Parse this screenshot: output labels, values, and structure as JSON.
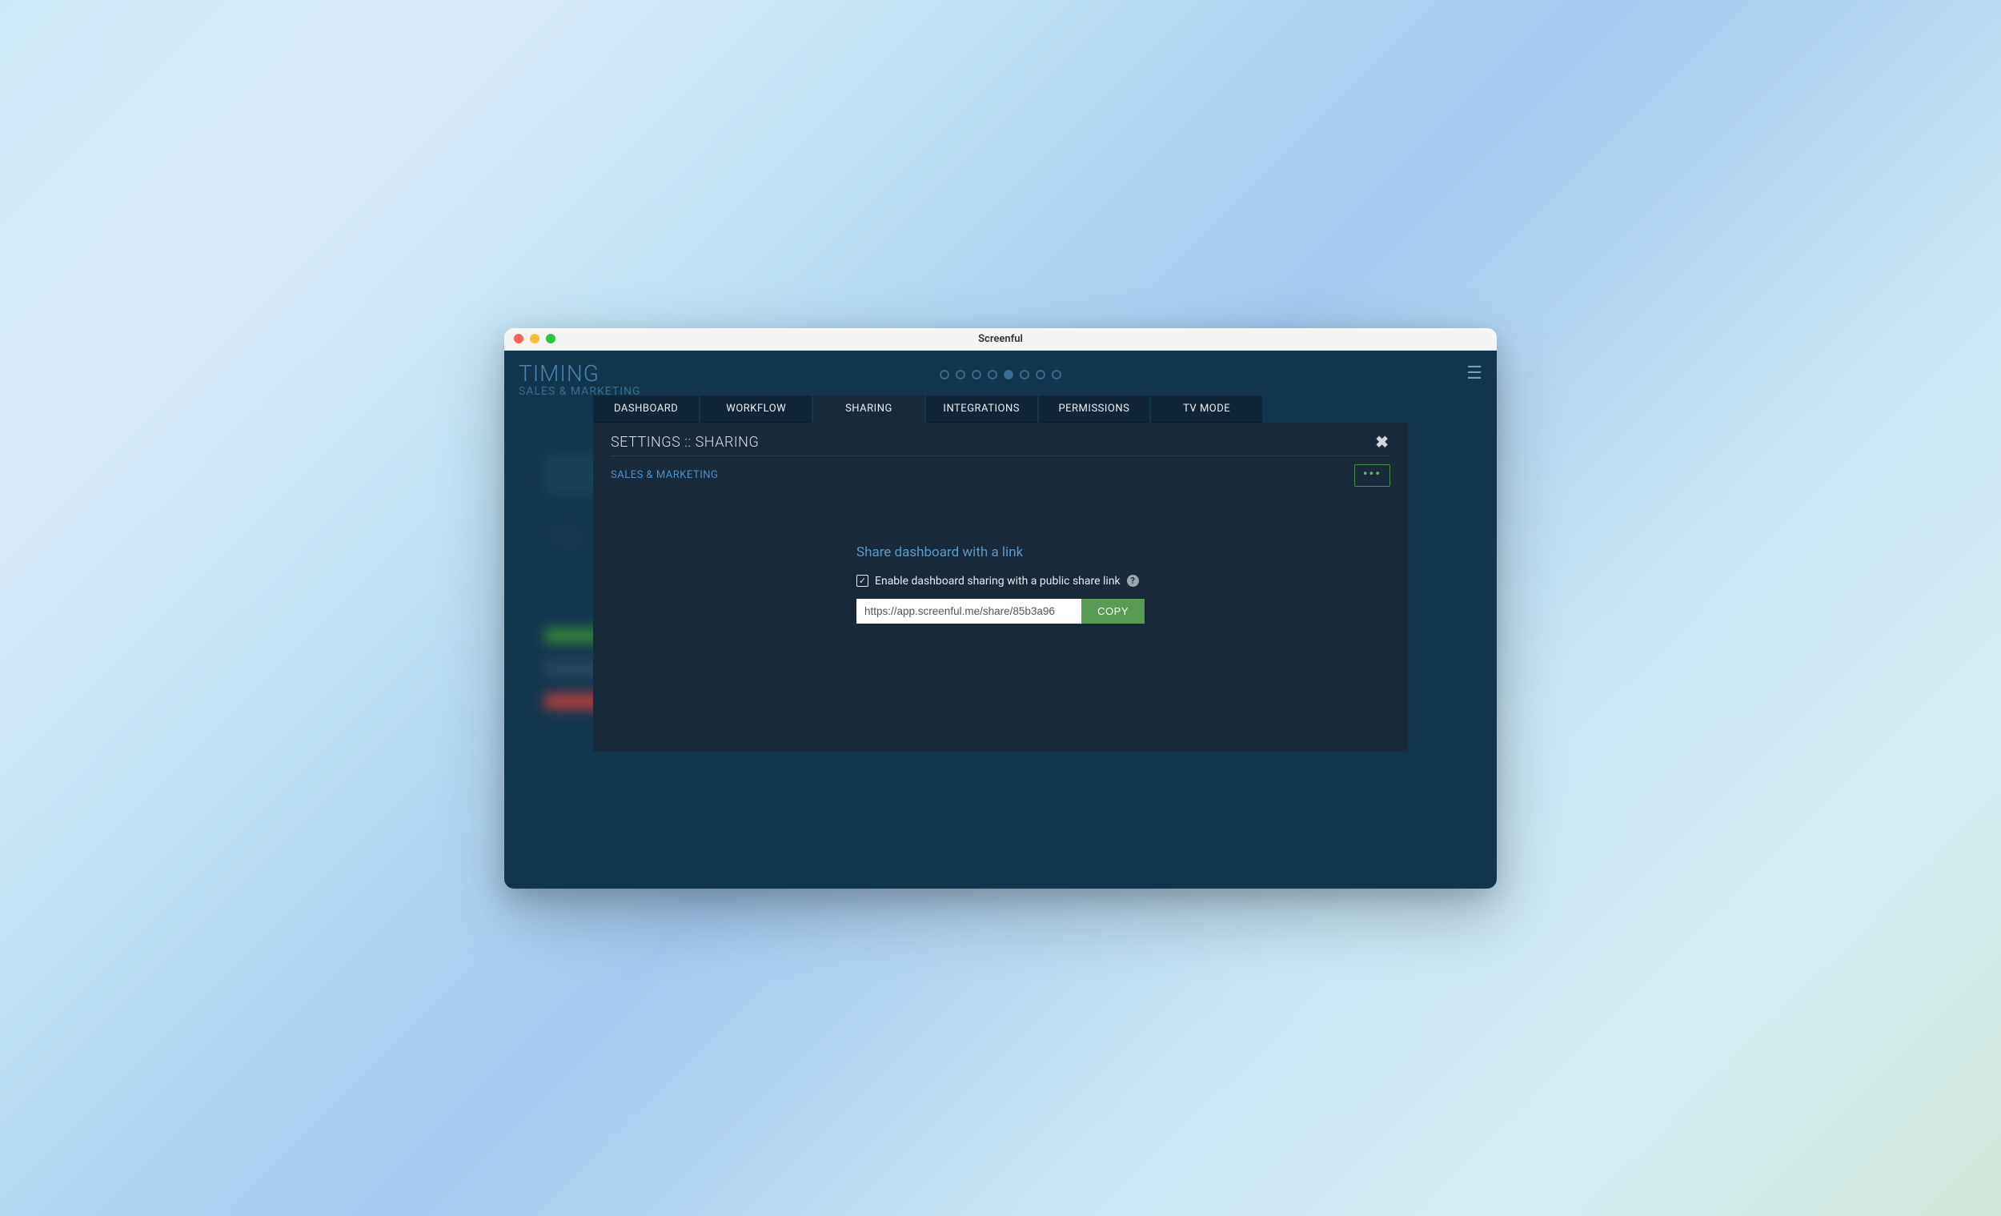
{
  "window": {
    "title": "Screenful"
  },
  "background": {
    "title": "TIMING",
    "subtitle": "SALES & MARKETING",
    "pager": {
      "count": 8,
      "active_index": 4
    }
  },
  "tabs": [
    {
      "label": "DASHBOARD"
    },
    {
      "label": "WORKFLOW"
    },
    {
      "label": "SHARING"
    },
    {
      "label": "INTEGRATIONS"
    },
    {
      "label": "PERMISSIONS"
    },
    {
      "label": "TV MODE"
    }
  ],
  "active_tab_index": 2,
  "modal": {
    "title": "SETTINGS :: SHARING",
    "subtitle": "SALES & MARKETING",
    "more_label": "•••",
    "share_heading": "Share dashboard with a link",
    "checkbox_label": "Enable dashboard sharing with a public share link",
    "checkbox_checked": true,
    "share_url": "https://app.screenful.me/share/85b3a96",
    "copy_label": "COPY"
  }
}
